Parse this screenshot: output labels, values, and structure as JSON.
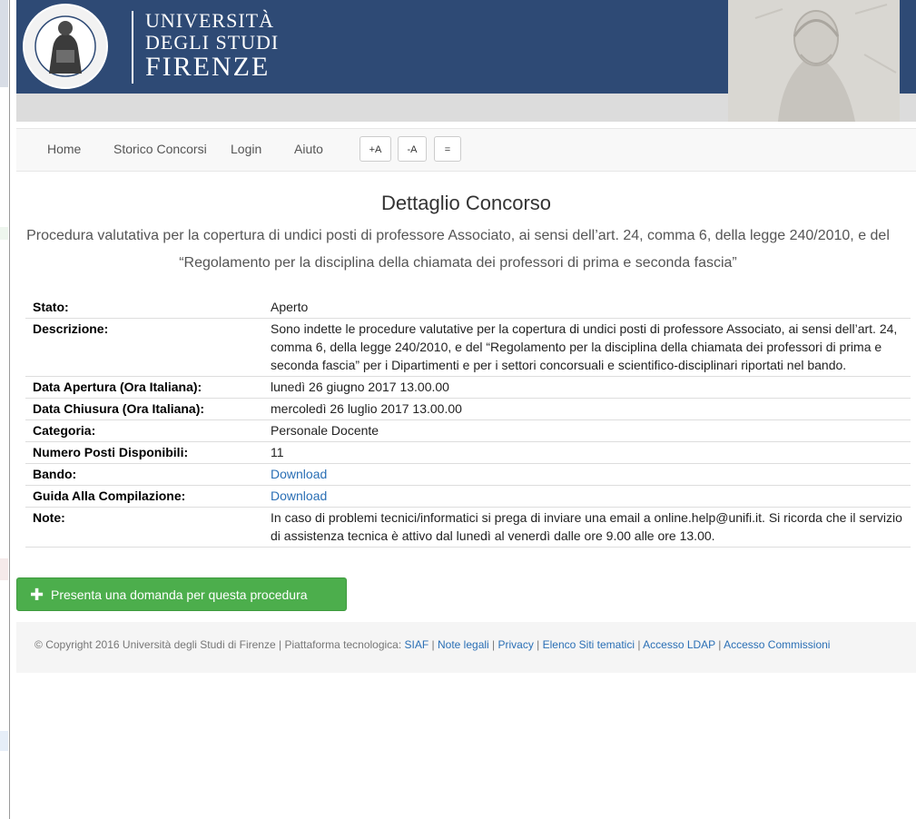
{
  "header": {
    "logo_line1": "UNIVERSITÀ",
    "logo_line2": "DEGLI STUDI",
    "logo_line3": "FIRENZE",
    "brand_color": "#2e4a75"
  },
  "nav": {
    "items": [
      {
        "label": "Home"
      },
      {
        "label": "Storico Concorsi"
      },
      {
        "label": "Login"
      },
      {
        "label": "Aiuto"
      }
    ],
    "font_increase": "+A",
    "font_decrease": "-A",
    "font_reset": "="
  },
  "page": {
    "title": "Dettaglio Concorso",
    "subtitle": "Procedura valutativa per la copertura di undici posti di professore Associato, ai sensi dell’art. 24, comma 6, della legge 240/2010, e del “Regolamento per la disciplina della chiamata dei professori di prima e seconda fascia”"
  },
  "details": {
    "stato": {
      "label": "Stato:",
      "value": "Aperto"
    },
    "descrizione": {
      "label": "Descrizione:",
      "value": "Sono indette le procedure valutative per la copertura di undici posti di professore Associato, ai sensi dell’art. 24, comma 6, della legge 240/2010, e del “Regolamento per la disciplina della chiamata dei professori di prima e seconda fascia” per i Dipartimenti e per i settori concorsuali e scientifico-disciplinari riportati nel bando."
    },
    "apertura": {
      "label": "Data Apertura (Ora Italiana):",
      "value": "lunedì 26 giugno 2017 13.00.00"
    },
    "chiusura": {
      "label": "Data Chiusura (Ora Italiana):",
      "value": "mercoledì 26 luglio 2017 13.00.00"
    },
    "categoria": {
      "label": "Categoria:",
      "value": "Personale Docente"
    },
    "posti": {
      "label": "Numero Posti Disponibili:",
      "value": "11"
    },
    "bando": {
      "label": "Bando:",
      "link": "Download"
    },
    "guida": {
      "label": "Guida Alla Compilazione:",
      "link": "Download"
    },
    "note": {
      "label": "Note:",
      "value": "In caso di problemi tecnici/informatici si prega di inviare una email a online.help@unifi.it. Si ricorda che il servizio di assistenza tecnica è attivo dal lunedì al venerdì dalle ore 9.00 alle ore 13.00."
    }
  },
  "apply_button": {
    "label": "Presenta una domanda per questa procedura",
    "color": "#4cae4c"
  },
  "footer": {
    "copyright": "Copyright 2016 Università degli Studi di Firenze | Piattaforma tecnologica:",
    "links": [
      "SIAF",
      "Note legali",
      "Privacy",
      "Elenco Siti tematici",
      "Accesso LDAP",
      "Accesso Commissioni"
    ]
  }
}
